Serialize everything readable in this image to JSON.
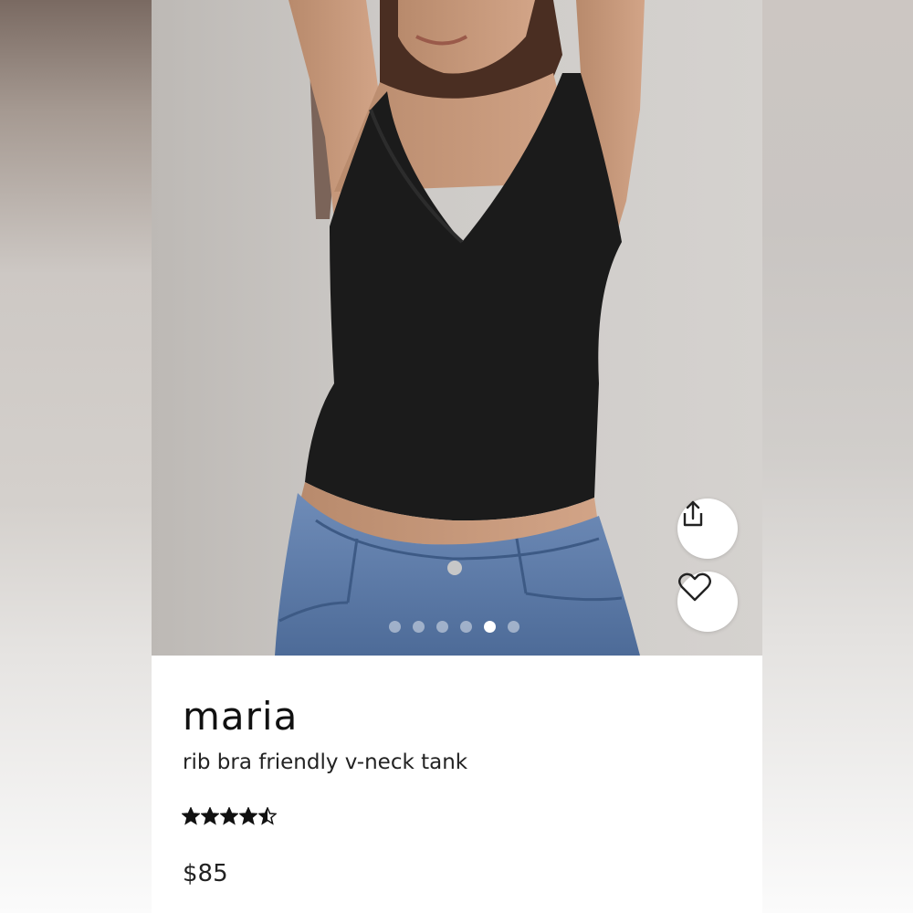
{
  "product": {
    "brand": "maria",
    "name": "rib bra friendly v-neck tank",
    "price": "$85",
    "rating": 4.5,
    "rating_max": 5
  },
  "gallery": {
    "image_count": 6,
    "active_index": 4
  },
  "actions": {
    "share_icon": "share-icon",
    "favorite_icon": "heart-icon"
  },
  "colors": {
    "tank": "#1b1b1b",
    "denim": "#5a7aa6",
    "wall": "#cfccc9"
  }
}
